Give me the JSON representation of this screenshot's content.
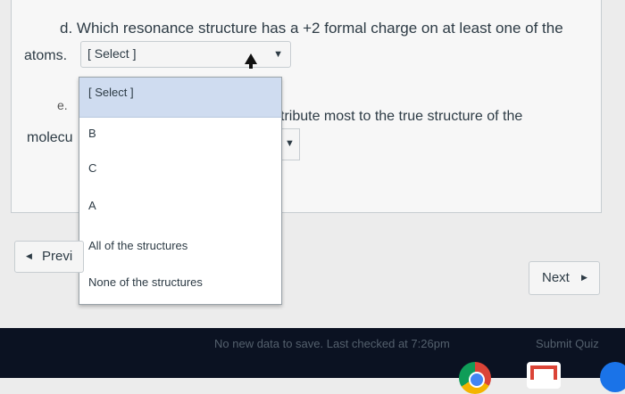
{
  "question_d": {
    "line1": "d. Which resonance structure has a +2 formal charge on at least one of the",
    "line2": "atoms.",
    "select_value": "[ Select ]"
  },
  "question_e": {
    "marker": "e.",
    "text_fragment": "tribute most to the true structure of the",
    "molecule_fragment": "molecu"
  },
  "dropdown": {
    "options": [
      "[ Select ]",
      "B",
      "C",
      "A",
      "All of the structures",
      "None of the structures"
    ],
    "selected_index": 0
  },
  "nav": {
    "previous_label": "Previ",
    "next_label": "Next"
  },
  "footer": {
    "status_text": "No new data to save. Last checked at 7:26pm",
    "submit_label": "Submit Quiz"
  },
  "icons": {
    "chevron": "chevron-down-icon",
    "prev_arrow": "triangle-left-icon",
    "next_arrow": "triangle-right-icon",
    "cursor": "mouse-pointer-icon"
  },
  "colors": {
    "highlight": "#cfdcf0",
    "footer_bg": "#0b1222"
  }
}
